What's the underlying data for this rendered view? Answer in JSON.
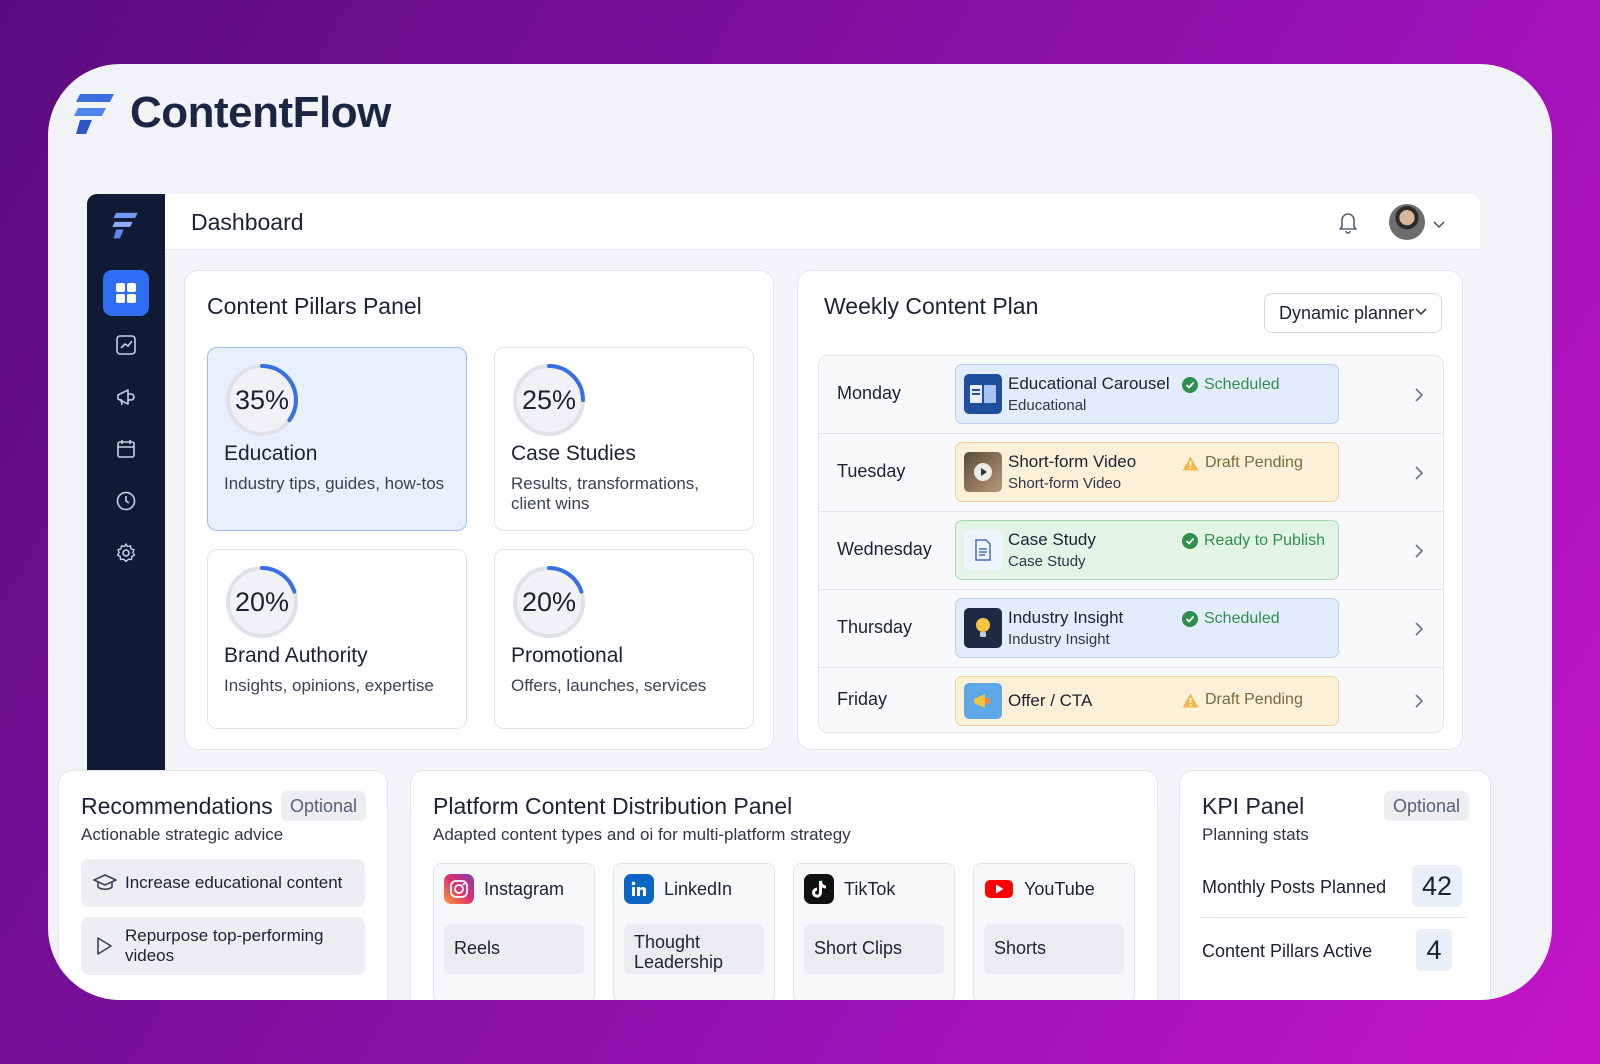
{
  "brand": {
    "name": "ContentFlow"
  },
  "topbar": {
    "title": "Dashboard"
  },
  "sidebar": {
    "items": [
      {
        "icon": "dashboard-icon",
        "active": true
      },
      {
        "icon": "analytics-icon"
      },
      {
        "icon": "megaphone-icon"
      },
      {
        "icon": "calendar-icon"
      },
      {
        "icon": "clock-icon"
      },
      {
        "icon": "gear-icon"
      }
    ]
  },
  "pillars": {
    "title": "Content Pillars Panel",
    "items": [
      {
        "percent": "35%",
        "share": 0.35,
        "name": "Education",
        "desc": "Industry tips, guides, how-tos"
      },
      {
        "percent": "25%",
        "share": 0.25,
        "name": "Case Studies",
        "desc": "Results, transformations, client wins"
      },
      {
        "percent": "20%",
        "share": 0.2,
        "name": "Brand Authority",
        "desc": "Insights, opinions, expertise"
      },
      {
        "percent": "20%",
        "share": 0.2,
        "name": "Promotional",
        "desc": "Offers, launches, services"
      }
    ]
  },
  "weekly": {
    "title": "Weekly Content Plan",
    "planner": "Dynamic planner",
    "rows": [
      {
        "day": "Monday",
        "title": "Educational Carousel",
        "sub": "Educational",
        "status": "Scheduled",
        "kind": "ok",
        "color": "blue"
      },
      {
        "day": "Tuesday",
        "title": "Short-form Video",
        "sub": "Short-form Video",
        "status": "Draft Pending",
        "kind": "warn",
        "color": "yellow"
      },
      {
        "day": "Wednesday",
        "title": "Case Study",
        "sub": "Case Study",
        "status": "Ready to Publish",
        "kind": "ok",
        "color": "green"
      },
      {
        "day": "Thursday",
        "title": "Industry Insight",
        "sub": "Industry Insight",
        "status": "Scheduled",
        "kind": "ok",
        "color": "blue"
      },
      {
        "day": "Friday",
        "title": "Offer / CTA",
        "sub": "",
        "status": "Draft Pending",
        "kind": "warn",
        "color": "yellow"
      }
    ]
  },
  "recommendations": {
    "title": "Recommendations",
    "badge": "Optional",
    "subtitle": "Actionable strategic advice",
    "items": [
      {
        "icon": "graduation-cap-icon",
        "label": "Increase educational content"
      },
      {
        "icon": "play-icon",
        "label": "Repurpose top-performing videos"
      }
    ]
  },
  "platforms": {
    "title": "Platform Content Distribution Panel",
    "subtitle": "Adapted content types and oi for multi-platform strategy",
    "items": [
      {
        "icon": "instagram-icon",
        "name": "Instagram",
        "type": "Reels"
      },
      {
        "icon": "linkedin-icon",
        "name": "LinkedIn",
        "type": "Thought Leadership"
      },
      {
        "icon": "tiktok-icon",
        "name": "TikTok",
        "type": "Short Clips"
      },
      {
        "icon": "youtube-icon",
        "name": "YouTube",
        "type": "Shorts"
      }
    ]
  },
  "kpi": {
    "title": "KPI Panel",
    "badge": "Optional",
    "subtitle": "Planning stats",
    "items": [
      {
        "label": "Monthly Posts Planned",
        "value": "42"
      },
      {
        "label": "Content Pillars Active",
        "value": "4"
      }
    ]
  },
  "colors": {
    "accent": "#2f6ef3",
    "sidebar": "#101a35",
    "ok": "#2f8f4e",
    "warn": "#f2b84b"
  }
}
